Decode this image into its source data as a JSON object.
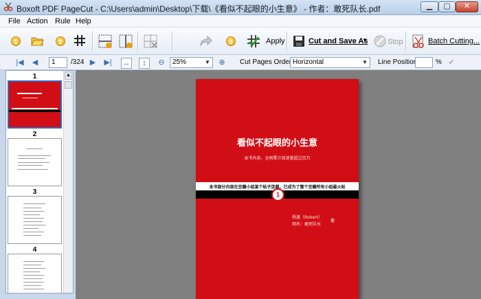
{
  "window": {
    "title": "Boxoft PDF PageCut - C:\\Users\\admin\\Desktop\\下载\\《看似不起眼的小生意》 - 作者：敢死队长.pdf",
    "min_glyph": "▁",
    "max_glyph": "▢",
    "close_glyph": "✕"
  },
  "menu": {
    "file": "File",
    "action": "Action",
    "rule": "Rule",
    "help": "Help"
  },
  "toolbar": {
    "step1": "1",
    "step2": "2",
    "step3": "3",
    "apply": "Apply",
    "cut_and_save": "Cut and Save As",
    "stop": "Stop",
    "batch": "Batch Cutting..."
  },
  "nav": {
    "current_page": "1",
    "total_pages": "/324",
    "zoom": "25%",
    "cut_label": "Cut Pages Order:",
    "cut_order": "Horizontal",
    "line_label": "Line Position:",
    "line_value": "",
    "percent": "%"
  },
  "thumbnails": [
    {
      "number": "1"
    },
    {
      "number": "2"
    },
    {
      "number": "3"
    },
    {
      "number": "4"
    }
  ],
  "page": {
    "title": "看似不起眼的小生意",
    "subtitle": "本书内容，全网累计阅读量超过百万",
    "band": "本书部分内容在豆瓣小组某个帖子连载，已成为了整个豆瓣所有小组最火帖",
    "marker": "1",
    "author_line1": "杨渡（Robert）",
    "author_line2": "网名：敢死队长",
    "author_tag": "著"
  },
  "colors": {
    "cover_red": "#d10e16",
    "viewer_bg": "#808080",
    "selection": "#316ac5"
  }
}
